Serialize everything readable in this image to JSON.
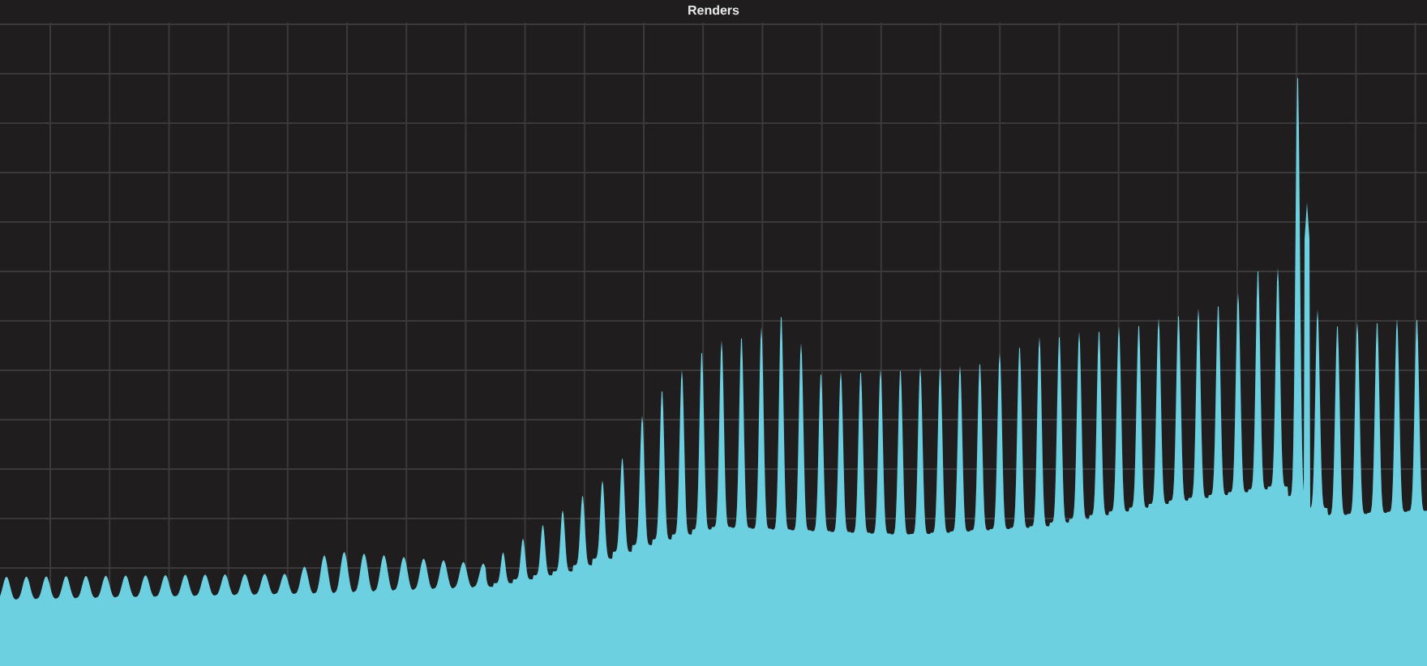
{
  "panel": {
    "title": "Renders"
  }
}
